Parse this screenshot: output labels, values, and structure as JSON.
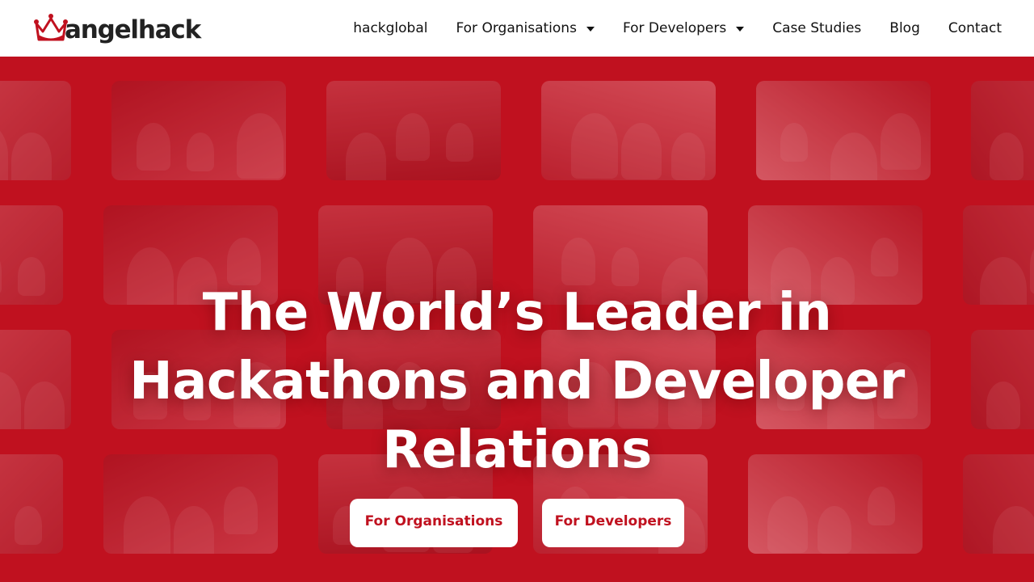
{
  "brand": {
    "logo_text": "angelhack",
    "accent_color": "#c0111f"
  },
  "nav": {
    "items": [
      {
        "label": "hackglobal",
        "has_dropdown": false
      },
      {
        "label": "For Organisations",
        "has_dropdown": true
      },
      {
        "label": "For Developers",
        "has_dropdown": true
      },
      {
        "label": "Case Studies",
        "has_dropdown": false
      },
      {
        "label": "Blog",
        "has_dropdown": false
      },
      {
        "label": "Contact",
        "has_dropdown": false
      }
    ]
  },
  "hero": {
    "headline_line1": "The World’s Leader in",
    "headline_line2": "Hackathons and Developer",
    "headline_line3": "Relations",
    "cta_organisations": "For Organisations",
    "cta_developers": "For Developers"
  }
}
